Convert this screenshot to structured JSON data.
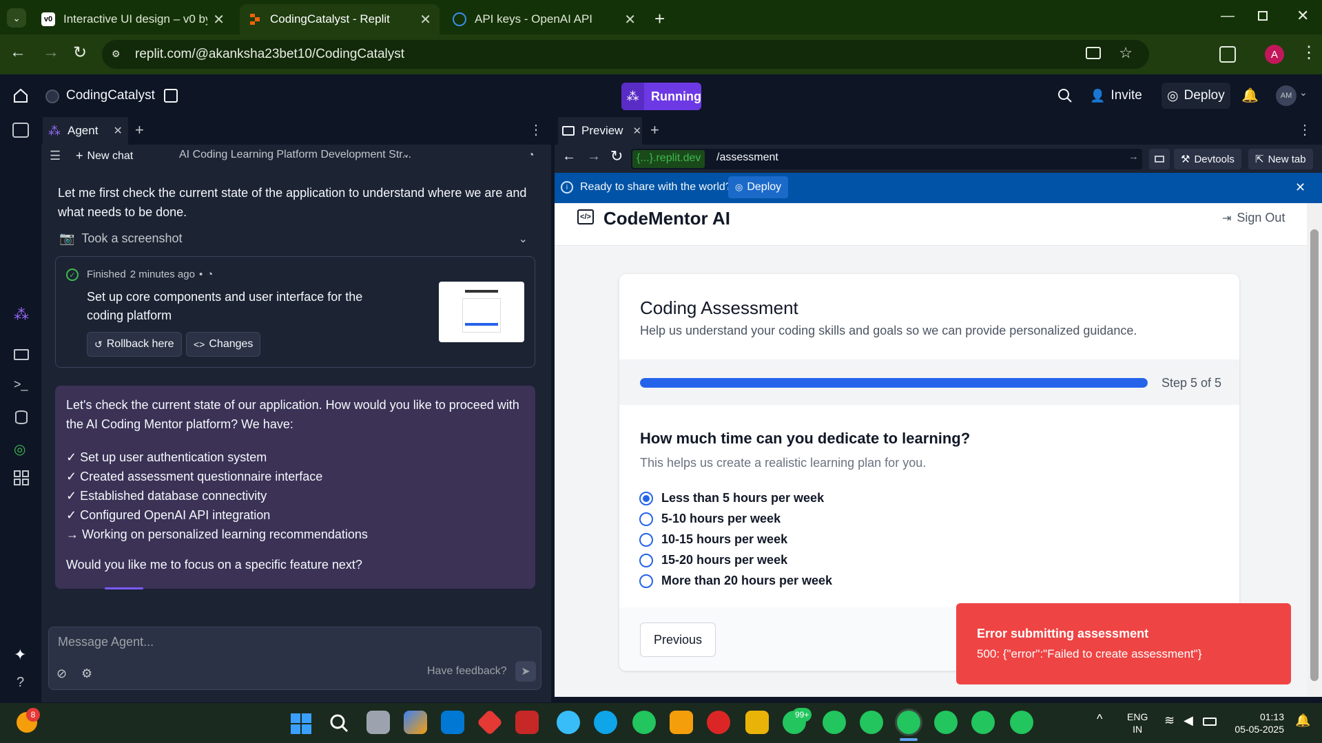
{
  "browser": {
    "tabs": [
      {
        "title": "Interactive UI design – v0 by Ve",
        "active": false
      },
      {
        "title": "CodingCatalyst - Replit",
        "active": true
      },
      {
        "title": "API keys - OpenAI API",
        "active": false
      }
    ],
    "url": "replit.com/@akanksha23bet10/CodingCatalyst",
    "profile_initial": "A"
  },
  "replit": {
    "project_name": "CodingCatalyst",
    "run_status": "Running",
    "invite_label": "Invite",
    "deploy_label": "Deploy",
    "avatar_initials": "AM"
  },
  "agent": {
    "tab_label": "Agent",
    "new_chat_label": "New chat",
    "chat_title": "AI Coding Learning Platform Development Str...",
    "intro_text": "Let me first check the current state of the application to understand where we are and what needs to be done.",
    "screenshot_label": "Took a screenshot",
    "checkpoint": {
      "status": "Finished",
      "time": "2 minutes ago",
      "sep": "•",
      "description": "Set up core components and user interface for the coding platform",
      "rollback_label": "Rollback here",
      "changes_label": "Changes"
    },
    "message": {
      "intro": "Let's check the current state of our application. How would you like to proceed with the AI Coding Mentor platform? We have:",
      "items": [
        "✓ Set up user authentication system",
        "✓ Created assessment questionnaire interface",
        "✓ Established database connectivity",
        "✓ Configured OpenAI API integration",
        "→ Working on personalized learning recommendations"
      ],
      "outro": "Would you like me to focus on a specific feature next?"
    },
    "input_placeholder": "Message Agent...",
    "feedback_label": "Have feedback?"
  },
  "preview": {
    "tab_label": "Preview",
    "domain_label": "{...}.replit.dev",
    "path": "/assessment",
    "devtools_label": "Devtools",
    "new_tab_label": "New tab",
    "banner_text": "Ready to share with the world?",
    "banner_deploy_label": "Deploy"
  },
  "app": {
    "brand": "CodeMentor AI",
    "sign_out_label": "Sign Out",
    "title": "Coding Assessment",
    "subtitle": "Help us understand your coding skills and goals so we can provide personalized guidance.",
    "progress_fraction": 1.0,
    "step_label": "Step 5 of 5",
    "question": "How much time can you dedicate to learning?",
    "question_hint": "This helps us create a realistic learning plan for you.",
    "options": [
      "Less than 5 hours per week",
      "5-10 hours per week",
      "10-15 hours per week",
      "15-20 hours per week",
      "More than 20 hours per week"
    ],
    "selected_option_index": 0,
    "previous_label": "Previous"
  },
  "toast": {
    "title": "Error submitting assessment",
    "message": "500: {\"error\":\"Failed to create assessment\"}"
  },
  "taskbar": {
    "weather_badge": "8",
    "whatsapp_badge": "99+",
    "lang_line1": "ENG",
    "lang_line2": "IN",
    "time": "01:13",
    "date": "05-05-2025"
  },
  "colors": {
    "chrome_bg": "#143207",
    "replit_bg": "#0e1525",
    "panel_bg": "#1c2333",
    "running_purple": "#6d39e5",
    "progress_blue": "#2563eb",
    "toast_red": "#ef4444",
    "banner_blue": "#0053a6"
  }
}
